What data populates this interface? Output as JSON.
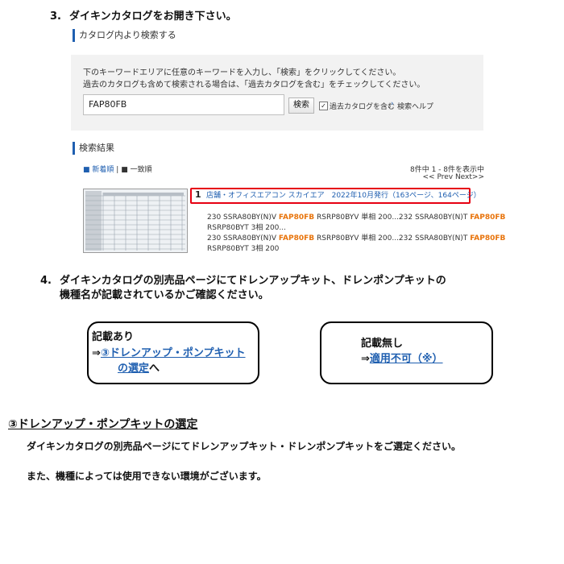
{
  "step3": {
    "number": "3.",
    "text": "ダイキンカタログをお開き下さい。"
  },
  "catalog_search": {
    "title": "カタログ内より検索する",
    "instruction_1": "下のキーワードエリアに任意のキーワードを入力し、「検索」をクリックしてください。",
    "instruction_2": "過去のカタログも含めて検索される場合は、「過去カタログを含む」をチェックしてください。",
    "keyword_value": "FAP80FB",
    "search_button": "検索",
    "include_past_label": "過去カタログを含む",
    "include_past_checked": true,
    "help_link": "検索ヘルプ"
  },
  "results": {
    "title": "検索結果",
    "sort_new": "新着順",
    "separator": "|",
    "sort_match": "一致順",
    "count_text": "8件中 1 - 8件を表示中",
    "pager": "<< Prev Next>>",
    "item": {
      "number": "1",
      "title": "店舗・オフィスエアコン スカイエア　2022年10月発行（163ページ、164ページ）",
      "snippet_lines": [
        {
          "a": "230 SSRA80BY(N)V ",
          "hl1": "FAP80FB",
          "b": " RSRP80BYV 単相 200...232 SSRA80BY(N)T ",
          "hl2": "FAP80FB"
        },
        {
          "a": "RSRP80BYT 3相 200...",
          "hl1": "",
          "b": "",
          "hl2": ""
        },
        {
          "a": "230 SSRA80BY(N)V ",
          "hl1": "FAP80FB",
          "b": " RSRP80BYV 単相 200...232 SSRA80BY(N)T ",
          "hl2": "FAP80FB"
        },
        {
          "a": "RSRP80BYT 3相 200",
          "hl1": "",
          "b": "",
          "hl2": ""
        }
      ]
    }
  },
  "step4": {
    "number": "4.",
    "line_1": "ダイキンカタログの別売品ページにてドレンアップキット、ドレンポンプキットの",
    "line_2": "機種名が記載されているかご確認ください。"
  },
  "box_listed": {
    "heading": "記載あり",
    "arrow": "⇒",
    "link_line_1": "③ドレンアップ・ポンプキット",
    "link_line_2": "の選定",
    "suffix": "へ"
  },
  "box_not_listed": {
    "heading": "記載無し",
    "arrow": "⇒",
    "link": "適用不可（※）"
  },
  "section3": {
    "title": "③ドレンアップ・ポンプキットの選定",
    "para_1": "ダイキンカタログの別売品ページにてドレンアップキット・ドレンポンプキットをご選定ください。",
    "para_2": "また、機種によっては使用できない環境がございます。"
  },
  "colors": {
    "accent_blue": "#1f5fb0",
    "highlight_orange": "#e8740c",
    "result_box_red": "#e60012"
  }
}
